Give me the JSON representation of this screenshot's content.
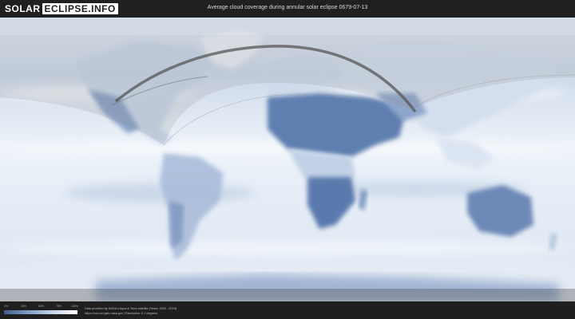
{
  "header": {
    "logo_solar": "SOLAR",
    "logo_eclipse": "ECLIPSE.INFO",
    "title": "Average cloud coverage during annular solar eclipse 0679-07-13"
  },
  "legend": {
    "ticks": [
      "0%",
      "25%",
      "50%",
      "75%",
      "100%"
    ],
    "gradient_colors": [
      "#3e5f8f",
      "#7e9cc4",
      "#c5d4e8",
      "#ffffff"
    ]
  },
  "credits": {
    "line1": "Data provided by NASA's Aqua & Terra satellite (Years: 2000 - 2019)",
    "line2": "https://neo.sci.gsfc.nasa.gov | Resolution: 0.1 degrees"
  },
  "colors": {
    "background": "#1f1f1f",
    "ocean_cloud": "#e3ebf5",
    "clear_sky": "#6f89b4",
    "eclipse_path": "#555555"
  }
}
